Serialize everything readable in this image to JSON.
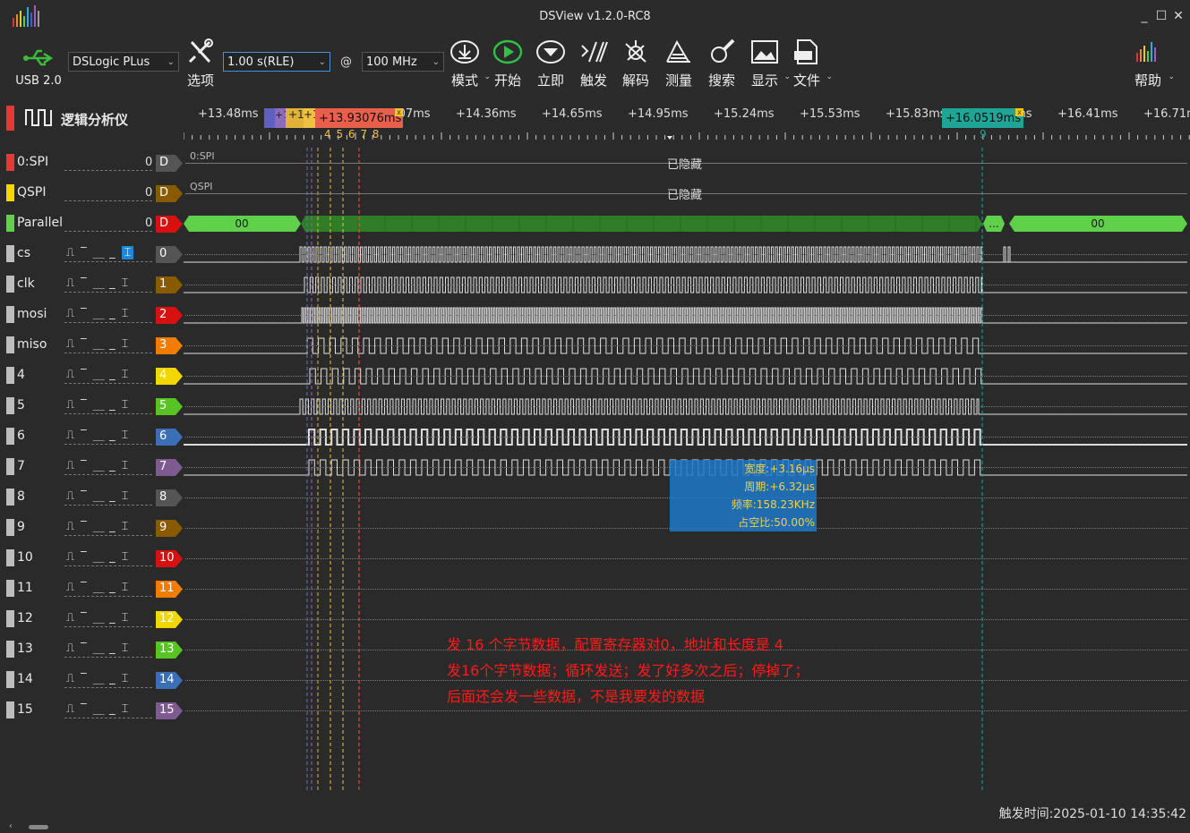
{
  "window": {
    "title": "DSView v1.2.0-RC8"
  },
  "toolbar": {
    "usb_label": "USB 2.0",
    "device": "DSLogic PLus",
    "options_label": "选项",
    "duration": "1.00 s(RLE)",
    "at": "@",
    "rate": "100 MHz",
    "mode_label": "模式",
    "start_label": "开始",
    "instant_label": "立即",
    "trigger_label": "触发",
    "decode_label": "解码",
    "measure_label": "测量",
    "search_label": "搜索",
    "display_label": "显示",
    "file_label": "文件",
    "help_label": "帮助"
  },
  "mode_tab": {
    "label": "逻辑分析仪"
  },
  "ruler": {
    "ticks": [
      "+13.48ms",
      "+13.77ms",
      "+14.07ms",
      "+14.36ms",
      "+14.65ms",
      "+14.95ms",
      "+15.24ms",
      "+15.53ms",
      "+15.83ms",
      "+16.12ms",
      "+16.41ms",
      "+16.71ms"
    ],
    "cursor_a": "+13.93076ms",
    "cursor_b": "+16.0519ms",
    "cursor_small": [
      "+1",
      "+1",
      "+1"
    ],
    "cursor_numbers": "4 5 6 7 8",
    "cursor_b_num": "9"
  },
  "decoders": [
    {
      "name": "0:SPI",
      "value": "0",
      "badge": "D",
      "label": "0:SPI",
      "state": "已隐藏",
      "color": "#e53935"
    },
    {
      "name": "QSPI",
      "value": "0",
      "badge": "D",
      "label": "QSPI",
      "state": "已隐藏",
      "color": "#f5d800"
    },
    {
      "name": "Parallel",
      "value": "0",
      "badge": "D",
      "first": "00",
      "ellipsis": "...",
      "last": "00",
      "color": "#5fd04a"
    }
  ],
  "channels": [
    {
      "name": "cs",
      "num": "0",
      "color": "#555555"
    },
    {
      "name": "clk",
      "num": "1",
      "color": "#8a5a00"
    },
    {
      "name": "mosi",
      "num": "2",
      "color": "#d81010"
    },
    {
      "name": "miso",
      "num": "3",
      "color": "#f07d00"
    },
    {
      "name": "4",
      "num": "4",
      "color": "#f2d600"
    },
    {
      "name": "5",
      "num": "5",
      "color": "#58c423"
    },
    {
      "name": "6",
      "num": "6",
      "color": "#3a6fb8"
    },
    {
      "name": "7",
      "num": "7",
      "color": "#7e5a90"
    },
    {
      "name": "8",
      "num": "8",
      "color": "#555555"
    },
    {
      "name": "9",
      "num": "9",
      "color": "#8a5a00"
    },
    {
      "name": "10",
      "num": "10",
      "color": "#d81010"
    },
    {
      "name": "11",
      "num": "11",
      "color": "#f07d00"
    },
    {
      "name": "12",
      "num": "12",
      "color": "#f2d600"
    },
    {
      "name": "13",
      "num": "13",
      "color": "#58c423"
    },
    {
      "name": "14",
      "num": "14",
      "color": "#3a6fb8"
    },
    {
      "name": "15",
      "num": "15",
      "color": "#7e5a90"
    }
  ],
  "trigger_glyphs": "⎍ ‾ ⎽ _ ⌶",
  "measure": {
    "width": "宽度:+3.16μs",
    "period": "周期:+6.32μs",
    "freq": "频率:158.23KHz",
    "duty": "占空比:50.00%"
  },
  "notes": [
    "发 16 个字节数据，配置寄存器对0，地址和长度是 4",
    "发16个字节数据；循环发送；发了好多次之后；停掉了；",
    "后面还会发一些数据，不是我要发的数据"
  ],
  "status": {
    "trigger_time": "触发时间:2025-01-10 14:35:42"
  }
}
